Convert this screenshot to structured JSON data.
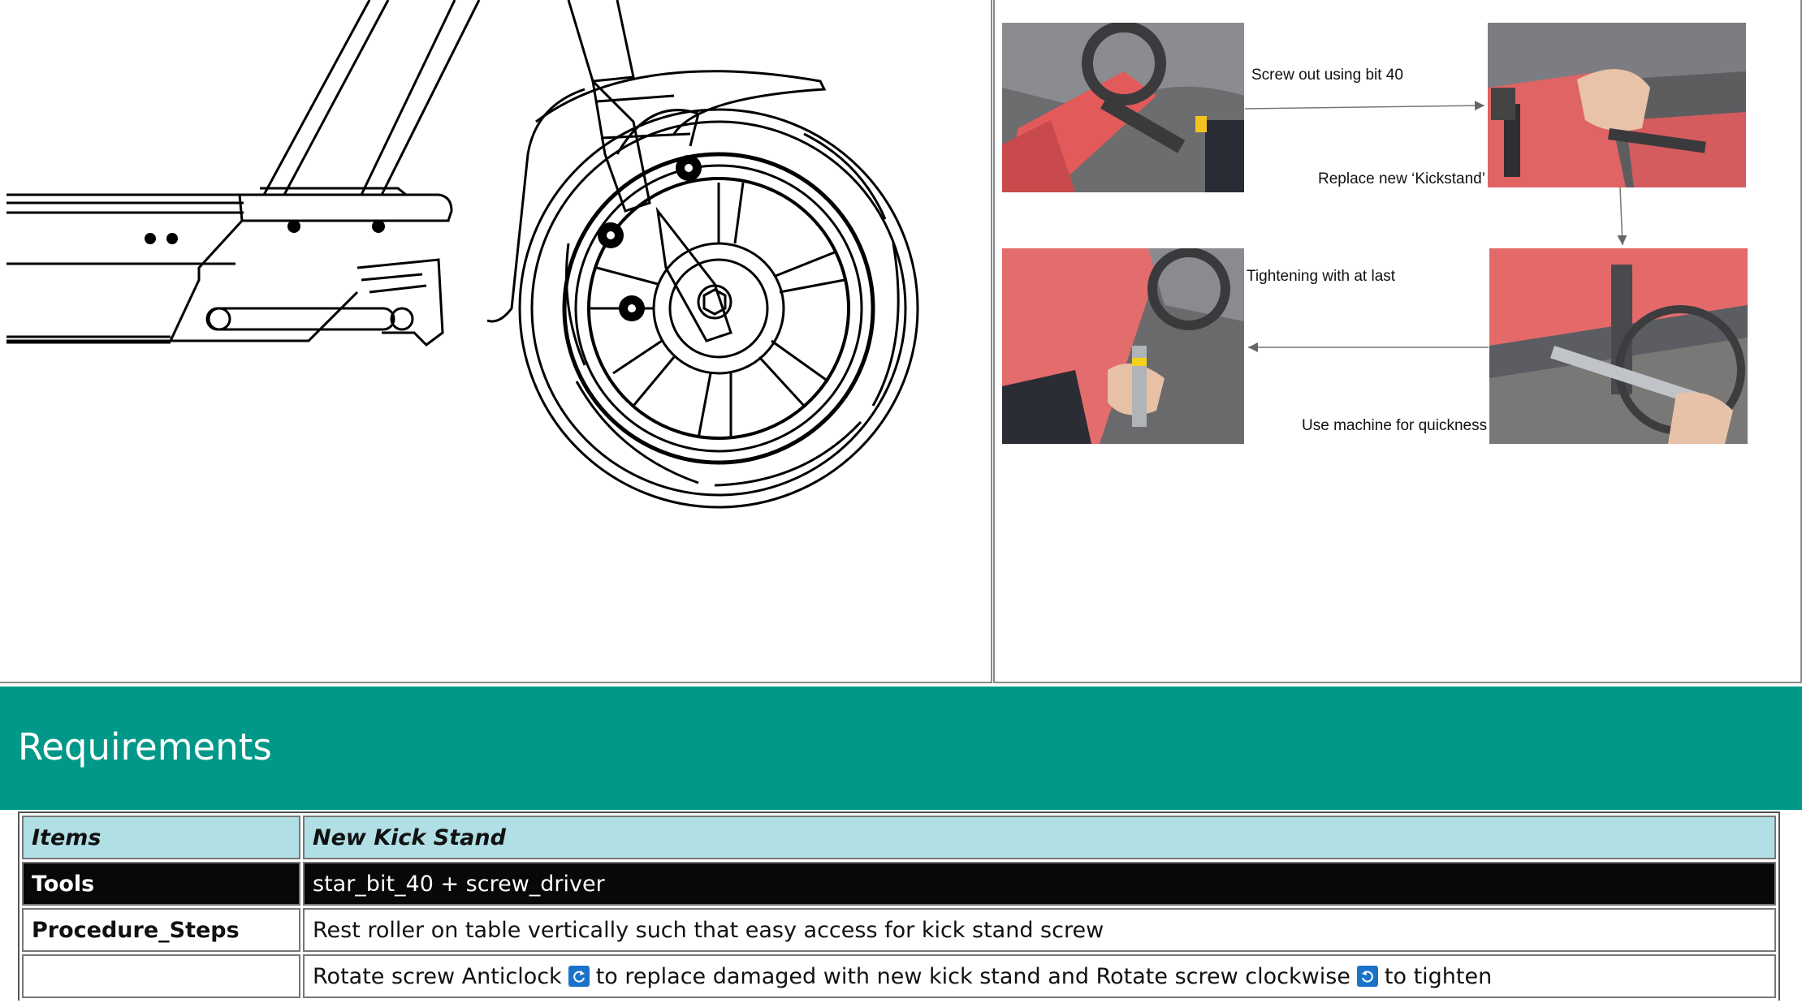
{
  "figure_panel": {
    "image_alt": "scooter-front-wheel-and-kickstand-line-drawing"
  },
  "steps_panel": {
    "captions": {
      "step1": "Screw out using bit 40",
      "step2": "Replace new ‘Kickstand’",
      "step3": "Tightening with at last",
      "step4": "Use machine for quickness"
    }
  },
  "requirements": {
    "title": "Requirements",
    "table": {
      "header": {
        "label": "Items",
        "value": "New Kick Stand"
      },
      "tools": {
        "label": "Tools",
        "value": "star_bit_40 + screw_driver"
      },
      "procedure": {
        "label": "Procedure_Steps",
        "value": "Rest roller on table vertically such that easy access for kick stand screw"
      },
      "step2": {
        "label": "",
        "part1": "Rotate screw Anticlock",
        "part2": "to replace damaged with new kick stand and Rotate screw clockwise",
        "part3": "to tighten"
      }
    }
  },
  "icons": {
    "anticlockwise": "rotate-anticlockwise-icon",
    "clockwise": "rotate-clockwise-icon"
  },
  "colors": {
    "banner": "#009888",
    "header_row": "#b1dfe6",
    "dark_row": "#090707",
    "icon_blue": "#1a73c9"
  }
}
